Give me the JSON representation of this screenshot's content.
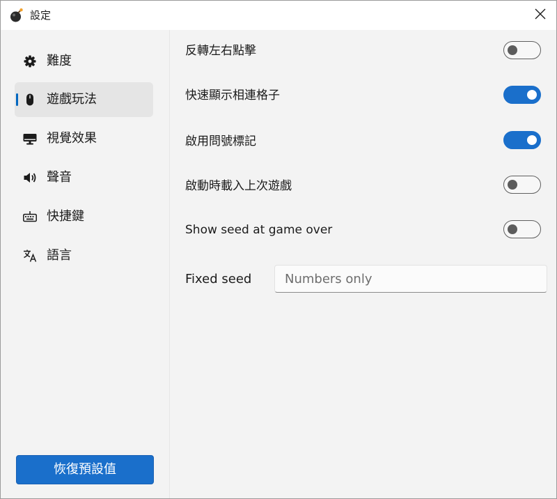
{
  "window": {
    "title": "設定",
    "app_icon": "bomb-icon",
    "close_icon": "close-icon"
  },
  "sidebar": {
    "items": [
      {
        "label": "難度",
        "icon": "gear-icon",
        "selected": false
      },
      {
        "label": "遊戲玩法",
        "icon": "mouse-icon",
        "selected": true
      },
      {
        "label": "視覺效果",
        "icon": "display-icon",
        "selected": false
      },
      {
        "label": "聲音",
        "icon": "speaker-icon",
        "selected": false
      },
      {
        "label": "快捷鍵",
        "icon": "keyboard-icon",
        "selected": false
      },
      {
        "label": "語言",
        "icon": "translate-icon",
        "selected": false
      }
    ],
    "reset_label": "恢復預設值"
  },
  "settings": [
    {
      "label": "反轉左右點擊",
      "enabled": false
    },
    {
      "label": "快速顯示相連格子",
      "enabled": true
    },
    {
      "label": "啟用問號標記",
      "enabled": true
    },
    {
      "label": "啟動時載入上次遊戲",
      "enabled": false
    },
    {
      "label": "Show seed at game over",
      "enabled": false
    }
  ],
  "seed": {
    "label": "Fixed seed",
    "placeholder": "Numbers only",
    "value": ""
  },
  "colors": {
    "accent": "#1a6fcb",
    "background": "#f3f3f3",
    "selected_item": "#e5e5e5"
  }
}
